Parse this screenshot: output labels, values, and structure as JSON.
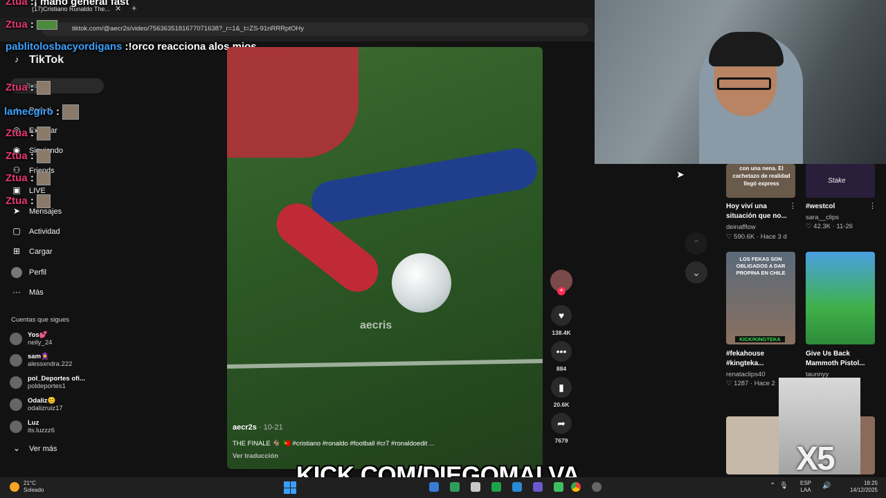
{
  "browser": {
    "tab_title": "(17)Cristiano Ronaldo The...",
    "url": "tiktok.com/@aecr2s/video/7563635181677071638?_r=1&_t=ZS-91nRRRptOHy"
  },
  "chat": [
    {
      "user": "Ztua",
      "message": ":¡ mano general fast"
    },
    {
      "user": "Ztua",
      "message": ":"
    },
    {
      "user": "pablitolosbacyordigans",
      "message": ":!orco reacciona alos mios"
    },
    {
      "user": "Ztua",
      "message": ":"
    },
    {
      "user": "lamecgiro",
      "message": ":"
    },
    {
      "user": "Ztua",
      "message": ":"
    },
    {
      "user": "Ztua",
      "message": ":"
    },
    {
      "user": "Ztua",
      "message": ":"
    },
    {
      "user": "Ztua",
      "message": ":"
    },
    {
      "user": "Ztua",
      "message": ":"
    }
  ],
  "sidebar": {
    "logo": "TikTok",
    "search_placeholder": "Buscar",
    "items": [
      {
        "label": "Para ti",
        "icon": "home-icon"
      },
      {
        "label": "Explorar",
        "icon": "compass-icon"
      },
      {
        "label": "Siguiendo",
        "icon": "following-icon"
      },
      {
        "label": "Friends",
        "icon": "friends-icon"
      },
      {
        "label": "LIVE",
        "icon": "live-icon"
      },
      {
        "label": "Mensajes",
        "icon": "messages-icon"
      },
      {
        "label": "Actividad",
        "icon": "activity-icon"
      },
      {
        "label": "Cargar",
        "icon": "upload-icon"
      },
      {
        "label": "Perfil",
        "icon": "profile-icon"
      },
      {
        "label": "Más",
        "icon": "more-icon"
      }
    ],
    "following_title": "Cuentas que sigues",
    "accounts": [
      {
        "name": "Yos💕",
        "handle": "neily_24"
      },
      {
        "name": "sam🧕",
        "handle": "alessxndra.222"
      },
      {
        "name": "pol_Deportes ofi...",
        "handle": "poldeportes1"
      },
      {
        "name": "Odaliz😊",
        "handle": "odalizruiz17"
      },
      {
        "name": "Luz",
        "handle": "its.luzzz6"
      }
    ],
    "see_more": "Ver más"
  },
  "video": {
    "watermark": "aecris",
    "author": "aecr2s",
    "date": "· 10-21",
    "caption": "THE FINALE 🐐 🇵🇹 #cristiano #ronaldo #football #cr7 #ronaldoedit ...",
    "translate": "Ver traducción"
  },
  "actions": {
    "likes": "138.4K",
    "comments": "884",
    "saves": "20.6K",
    "shares": "7679"
  },
  "recommendations": [
    {
      "thumb_text": "con una nena. El cachetazo de realidad llegó express",
      "title": "Hoy viví una situación que no...",
      "author": "deinafflow",
      "meta": "♡ 590.6K · Hace 3 d"
    },
    {
      "thumb_text": "Stake",
      "title": "#westcol",
      "author": "sara__clips",
      "meta": "♡ 42.3K · 11-26"
    },
    {
      "thumb_text": "LOS FEKAS SON OBLIGADOS A DAR PROPINA EN CHILE",
      "badge": "KICK/KINGTEKA",
      "title": "#fekahouse #kingteka...",
      "author": "renataclips40",
      "meta": "♡ 1287 · Hace 2"
    },
    {
      "title": "Give Us Back Mammoth Pistol...",
      "author": "taunnyy"
    }
  ],
  "overlay": {
    "kick_banner": "KICK.COM/DIEGOMALVA",
    "multiplier": "X5"
  },
  "taskbar": {
    "temp": "21°C",
    "weather": "Soleado",
    "lang": "ESP",
    "lang2": "LAA",
    "time": "18:25",
    "date": "14/12/2025"
  }
}
